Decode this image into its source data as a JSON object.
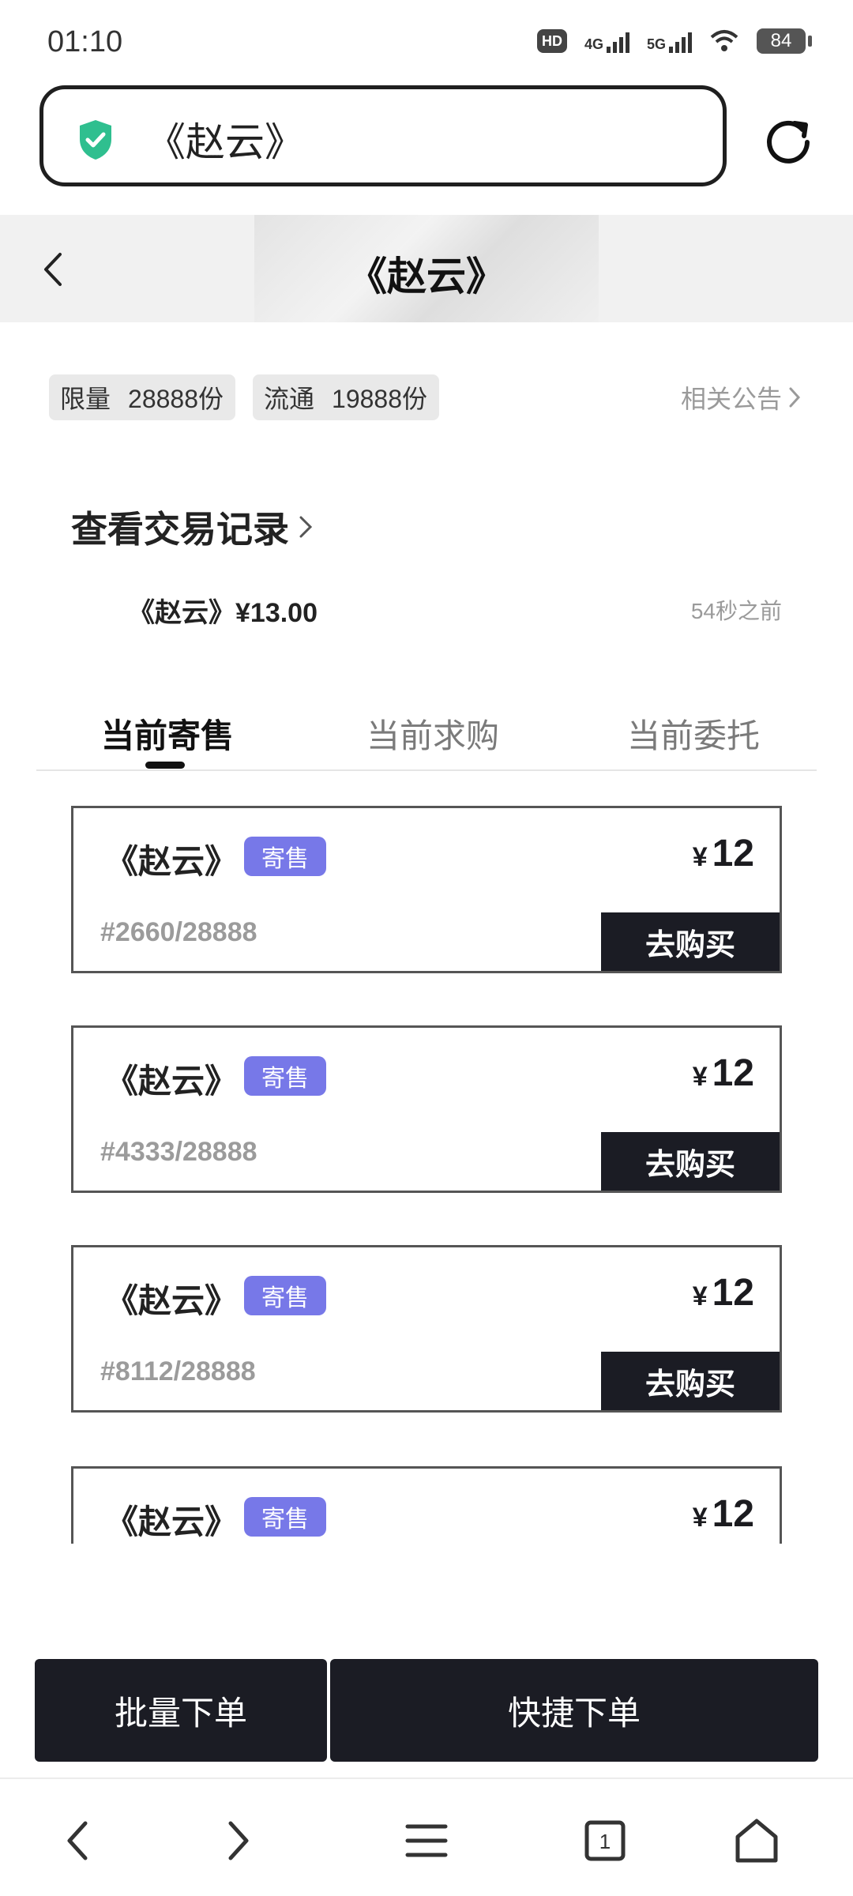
{
  "status_bar": {
    "time": "01:10",
    "hd_label": "HD",
    "network_1": "4G",
    "network_2": "5G",
    "battery": "84"
  },
  "address_bar": {
    "url_text": "《赵云》",
    "security_icon": "shield-check-icon",
    "reload_icon": "reload-icon"
  },
  "header": {
    "title": "《赵云》"
  },
  "stats": {
    "limit_label": "限量",
    "limit_value": "28888份",
    "circulation_label": "流通",
    "circulation_value": "19888份",
    "announcement_link": "相关公告"
  },
  "records": {
    "link": "查看交易记录",
    "latest_item": "《赵云》",
    "latest_price": "¥13.00",
    "latest_time": "54秒之前"
  },
  "tabs": [
    {
      "label": "当前寄售",
      "active": true
    },
    {
      "label": "当前求购",
      "active": false
    },
    {
      "label": "当前委托",
      "active": false
    }
  ],
  "listings": [
    {
      "title": "《赵云》",
      "tag": "寄售",
      "currency": "¥",
      "price": "12",
      "serial": "#2660/28888",
      "button": "去购买"
    },
    {
      "title": "《赵云》",
      "tag": "寄售",
      "currency": "¥",
      "price": "12",
      "serial": "#4333/28888",
      "button": "去购买"
    },
    {
      "title": "《赵云》",
      "tag": "寄售",
      "currency": "¥",
      "price": "12",
      "serial": "#8112/28888",
      "button": "去购买"
    },
    {
      "title": "《赵云》",
      "tag": "寄售",
      "currency": "¥",
      "price": "12",
      "serial": "",
      "button": ""
    }
  ],
  "actions": {
    "batch_order": "批量下单",
    "quick_order": "快捷下单"
  },
  "browser_nav": {
    "tab_count": "1",
    "icons": [
      "back-arrow-icon",
      "forward-arrow-icon",
      "menu-icon",
      "tabs-icon",
      "home-icon"
    ]
  },
  "colors": {
    "accent_tag": "#7778e8",
    "dark_button": "#1b1c24",
    "shield_green": "#2fbf8f"
  }
}
